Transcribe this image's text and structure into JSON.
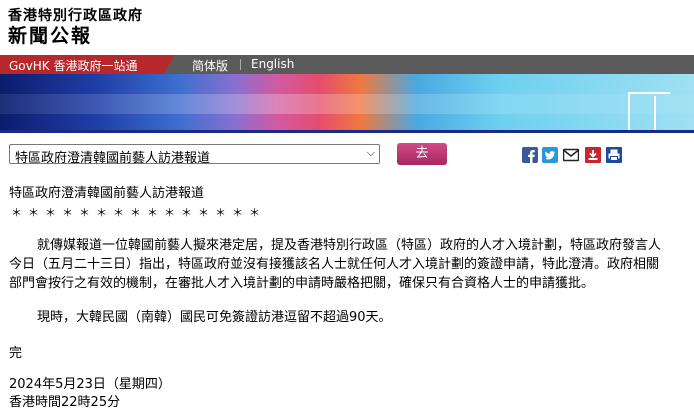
{
  "header": {
    "org_name": "香港特別行政區政府",
    "site_name": "新聞公報"
  },
  "nav": {
    "govhk": "GovHK 香港政府一站通",
    "simplified": "简体版",
    "english": "English"
  },
  "article_select": {
    "selected": "特區政府澄清韓國前藝人訪港報道",
    "go_label": "去"
  },
  "share_icons": [
    "facebook-icon",
    "twitter-icon",
    "email-icon",
    "download-icon",
    "print-icon"
  ],
  "colors": {
    "govhk_red": "#b6282c",
    "nav_gray": "#5a5a5a",
    "go_button": "#c03a78",
    "facebook": "#3b5998",
    "twitter": "#2a97d8"
  },
  "article": {
    "title": "特區政府澄清韓國前藝人訪港報道",
    "stars": "＊＊＊＊＊＊＊＊＊＊＊＊＊＊＊",
    "paragraphs": [
      "就傳媒報道一位韓國前藝人擬來港定居，提及香港特別行政區（特區）政府的人才入境計劃，特區政府發言人今日（五月二十三日）指出，特區政府並沒有接獲該名人士就任何人才入境計劃的簽證申請，特此澄清。政府相關部門會按行之有效的機制，在審批人才入境計劃的申請時嚴格把關，確保只有合資格人士的申請獲批。",
      "現時，大韓民國（南韓）國民可免簽證訪港逗留不超過90天。"
    ],
    "end_mark": "完",
    "date": "2024年5月23日（星期四）",
    "time": "香港時間22時25分"
  }
}
